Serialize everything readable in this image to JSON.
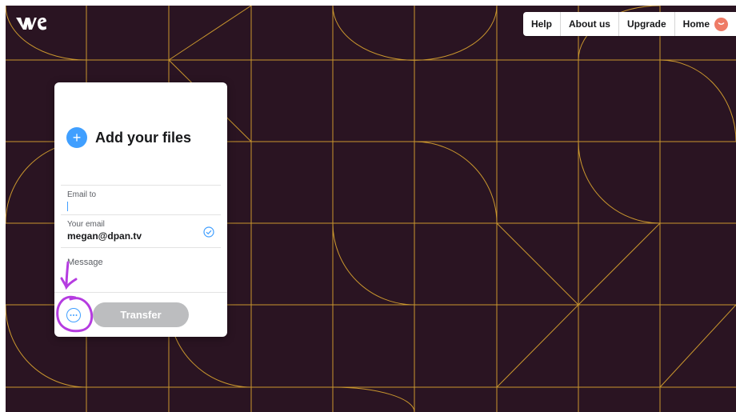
{
  "app": {
    "logo": "we",
    "colors": {
      "background": "#2a1422",
      "grid_line": "#c9962e",
      "accent": "#409fff",
      "avatar": "#ee7b66",
      "annotation": "#b53ce0"
    }
  },
  "topnav": {
    "items": [
      {
        "label": "Help"
      },
      {
        "label": "About us"
      },
      {
        "label": "Upgrade"
      },
      {
        "label": "Home"
      }
    ]
  },
  "panel": {
    "add_files_label": "Add your files",
    "email_to": {
      "label": "Email to",
      "value": ""
    },
    "your_email": {
      "label": "Your email",
      "value": "megan@dpan.tv"
    },
    "message": {
      "placeholder": "Message"
    },
    "transfer_label": "Transfer",
    "more_options_icon": "ellipsis-icon"
  },
  "annotation": {
    "type": "hand-drawn-arrow-and-circle",
    "target": "more-options-button"
  }
}
